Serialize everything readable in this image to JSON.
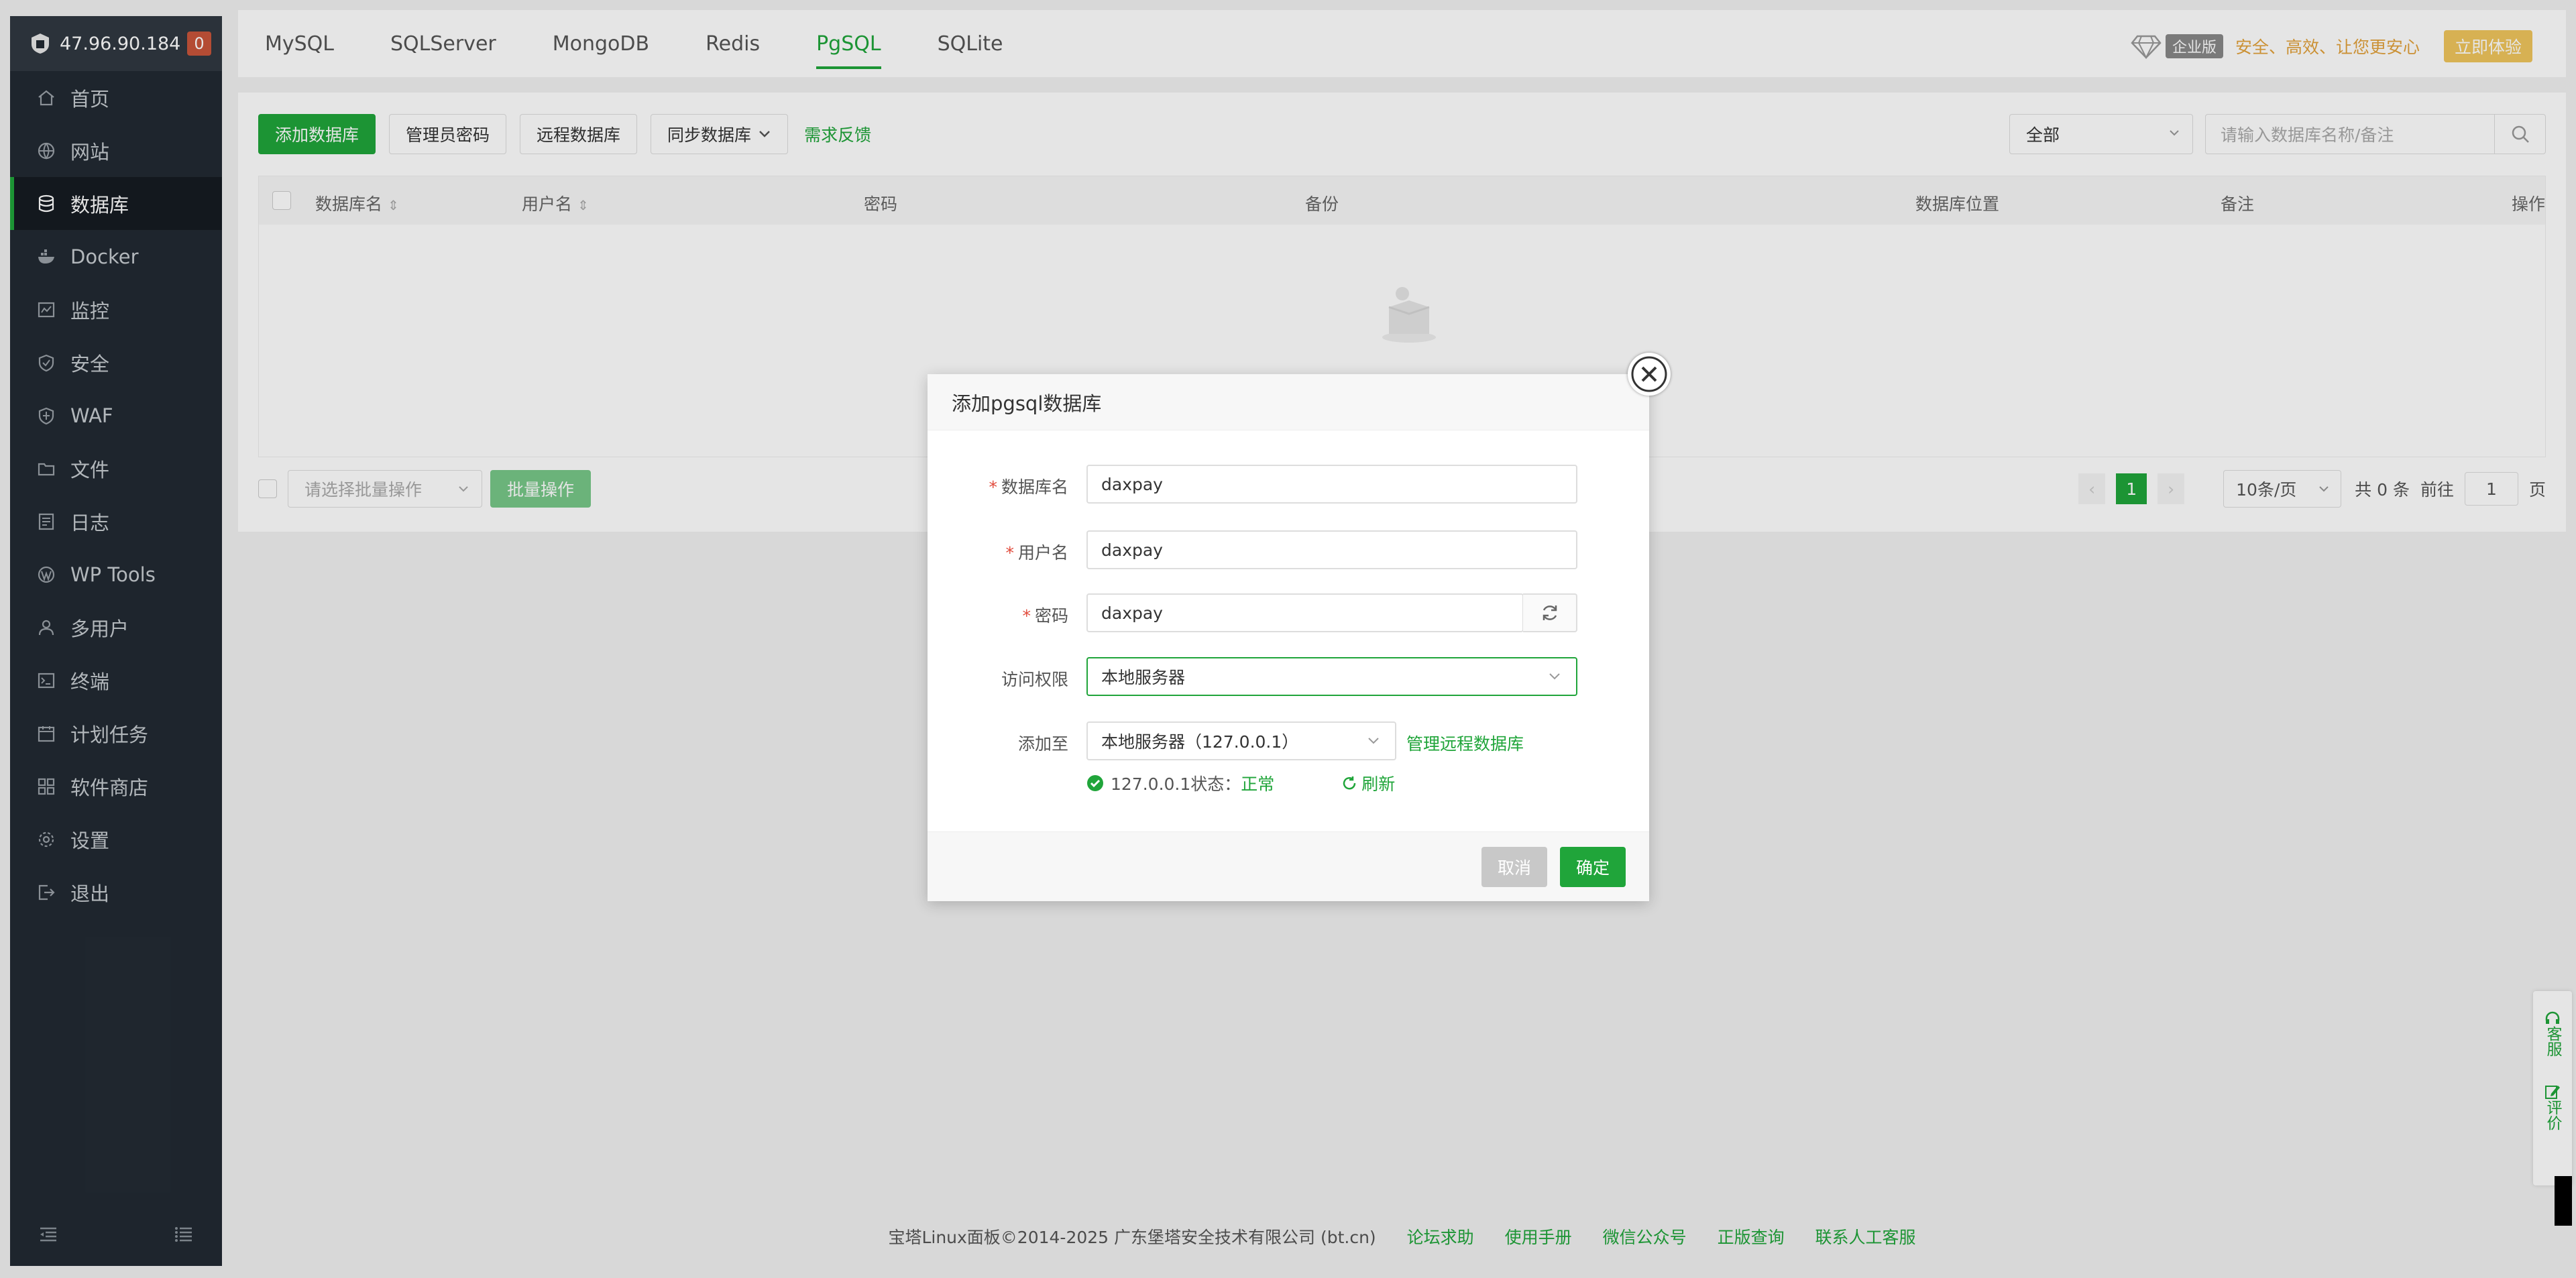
{
  "sidebar": {
    "ip": "47.96.90.184",
    "badge": "0",
    "items": [
      {
        "label": "首页",
        "icon": "home-icon"
      },
      {
        "label": "网站",
        "icon": "globe-icon"
      },
      {
        "label": "数据库",
        "icon": "database-icon",
        "active": true
      },
      {
        "label": "Docker",
        "icon": "docker-icon"
      },
      {
        "label": "监控",
        "icon": "monitor-icon"
      },
      {
        "label": "安全",
        "icon": "shield-icon"
      },
      {
        "label": "WAF",
        "icon": "waf-shield-icon"
      },
      {
        "label": "文件",
        "icon": "folder-icon"
      },
      {
        "label": "日志",
        "icon": "log-icon"
      },
      {
        "label": "WP Tools",
        "icon": "wordpress-icon"
      },
      {
        "label": "多用户",
        "icon": "users-icon"
      },
      {
        "label": "终端",
        "icon": "terminal-icon"
      },
      {
        "label": "计划任务",
        "icon": "calendar-icon"
      },
      {
        "label": "软件商店",
        "icon": "apps-icon"
      },
      {
        "label": "设置",
        "icon": "gear-icon"
      },
      {
        "label": "退出",
        "icon": "logout-icon"
      }
    ]
  },
  "tabs": [
    "MySQL",
    "SQLServer",
    "MongoDB",
    "Redis",
    "PgSQL",
    "SQLite"
  ],
  "active_tab": "PgSQL",
  "promo": {
    "edition": "企业版",
    "slogan": "安全、高效、让您更安心",
    "try_label": "立即体验"
  },
  "toolbar": {
    "add_db": "添加数据库",
    "admin_pwd": "管理员密码",
    "remote_db": "远程数据库",
    "sync_db": "同步数据库",
    "feedback": "需求反馈"
  },
  "filter": {
    "select_value": "全部",
    "search_placeholder": "请输入数据库名称/备注"
  },
  "table": {
    "columns": [
      "数据库名",
      "用户名",
      "密码",
      "备份",
      "数据库位置",
      "备注",
      "操作"
    ]
  },
  "bottom": {
    "batch_placeholder": "请选择批量操作",
    "batch_btn": "批量操作",
    "page": "1",
    "page_size": "10条/页",
    "total": "共 0 条",
    "goto": "前往",
    "goto_page": "1",
    "page_unit": "页"
  },
  "modal": {
    "title": "添加pgsql数据库",
    "db_name_label": "数据库名",
    "db_name_value": "daxpay",
    "user_label": "用户名",
    "user_value": "daxpay",
    "pwd_label": "密码",
    "pwd_value": "daxpay",
    "access_label": "访问权限",
    "access_value": "本地服务器",
    "addto_label": "添加至",
    "addto_value": "本地服务器（127.0.0.1）",
    "manage_remote": "管理远程数据库",
    "status_prefix": "127.0.0.1状态：",
    "status_value": "正常",
    "refresh": "刷新",
    "cancel": "取消",
    "confirm": "确定"
  },
  "footer": {
    "copyright": "宝塔Linux面板©2014-2025 广东堡塔安全技术有限公司 (bt.cn)",
    "links": [
      "论坛求助",
      "使用手册",
      "微信公众号",
      "正版查询",
      "联系人工客服"
    ]
  },
  "float": {
    "service": "客服",
    "review": "评价"
  },
  "colors": {
    "accent": "#20a53a",
    "sidebar_bg": "#222a33",
    "gold": "#e3a23c"
  }
}
